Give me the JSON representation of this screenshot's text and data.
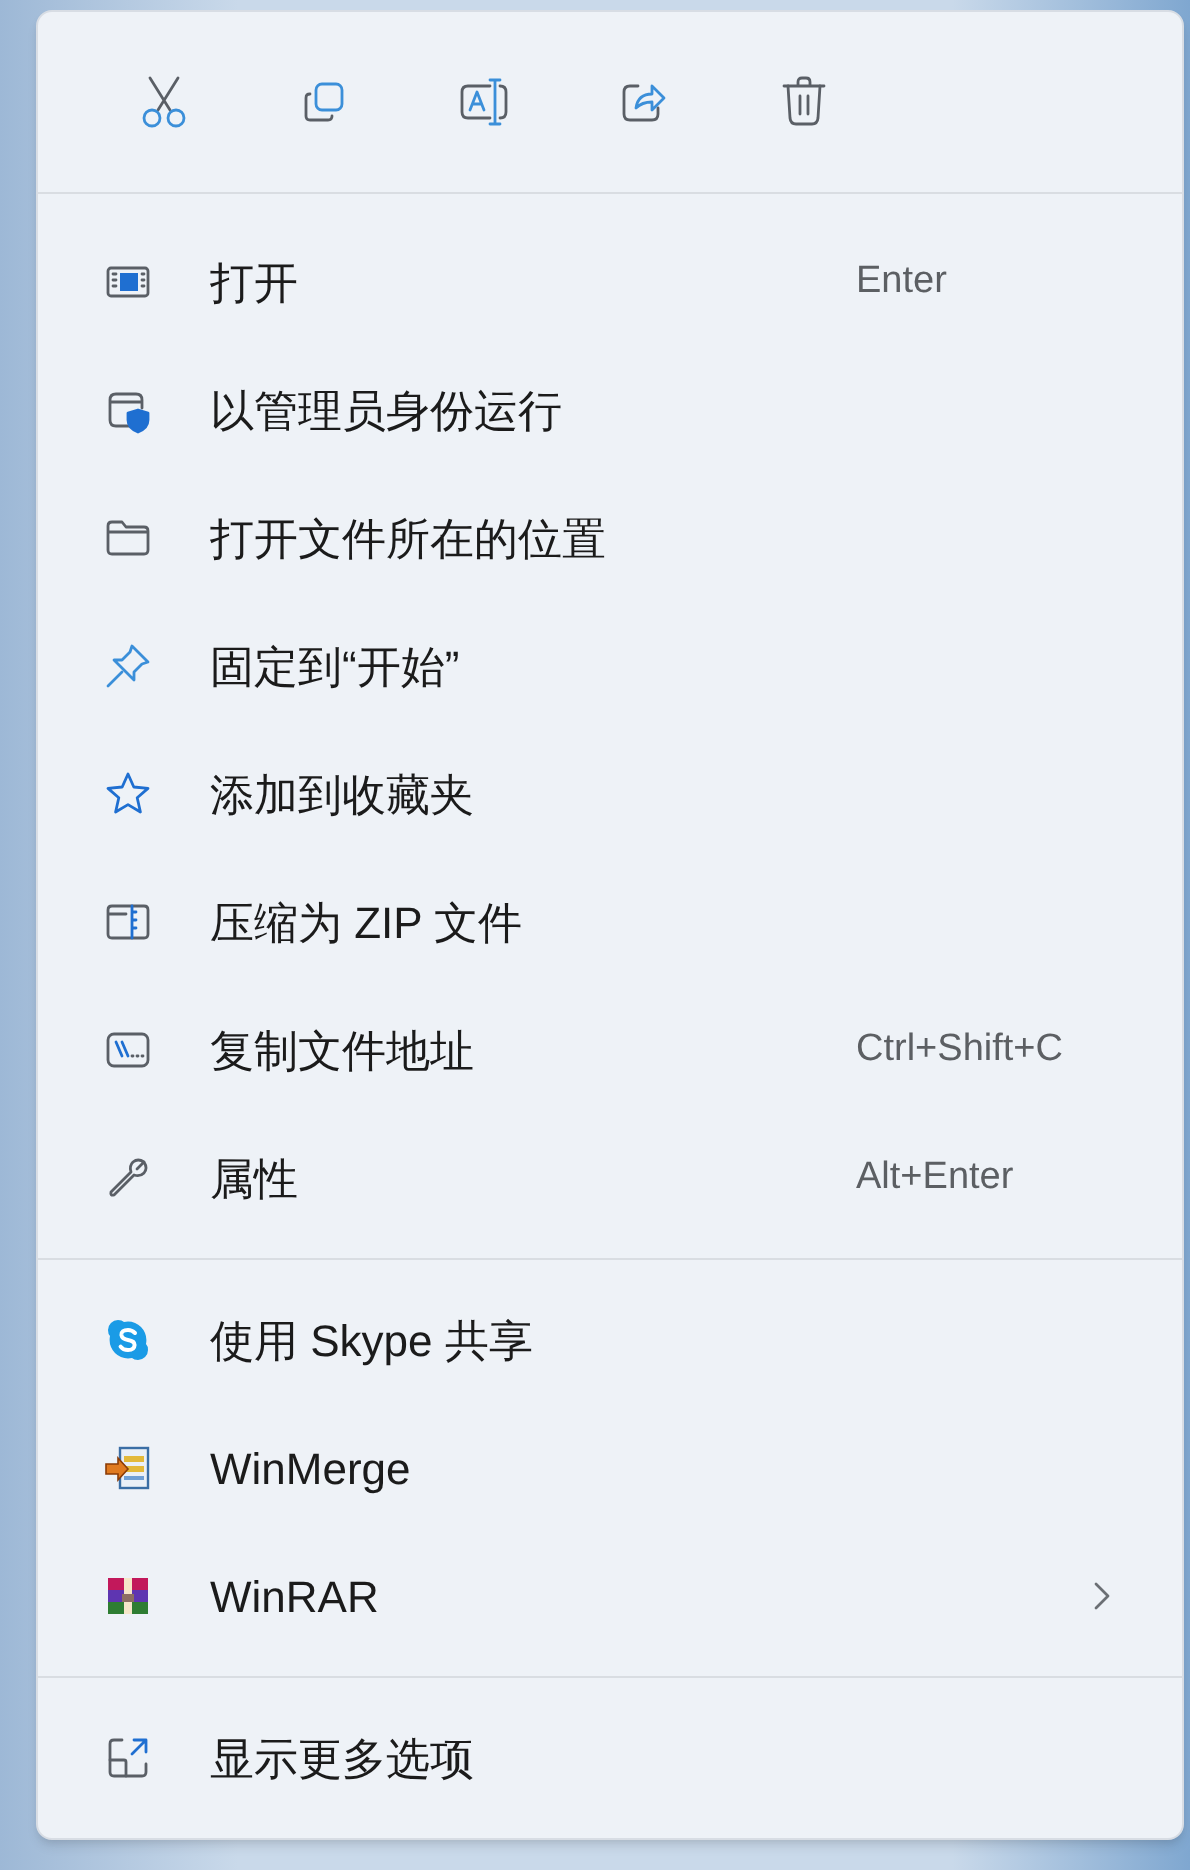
{
  "context_menu": {
    "sections": [
      {
        "items": [
          {
            "label": "打开",
            "shortcut": "Enter",
            "submenu": false
          },
          {
            "label": "以管理员身份运行",
            "submenu": false
          },
          {
            "label": "打开文件所在的位置",
            "submenu": false
          },
          {
            "label": "固定到“开始”",
            "submenu": false
          },
          {
            "label": "添加到收藏夹",
            "submenu": false
          },
          {
            "label": "压缩为 ZIP 文件",
            "submenu": false
          },
          {
            "label": "复制文件地址",
            "shortcut": "Ctrl+Shift+C",
            "submenu": false
          },
          {
            "label": "属性",
            "shortcut": "Alt+Enter",
            "submenu": false
          }
        ]
      },
      {
        "items": [
          {
            "label": "使用 Skype 共享",
            "submenu": false
          },
          {
            "label": "WinMerge",
            "submenu": false
          },
          {
            "label": "WinRAR",
            "submenu": true
          }
        ]
      },
      {
        "items": [
          {
            "label": "显示更多选项",
            "submenu": false
          }
        ]
      }
    ]
  }
}
